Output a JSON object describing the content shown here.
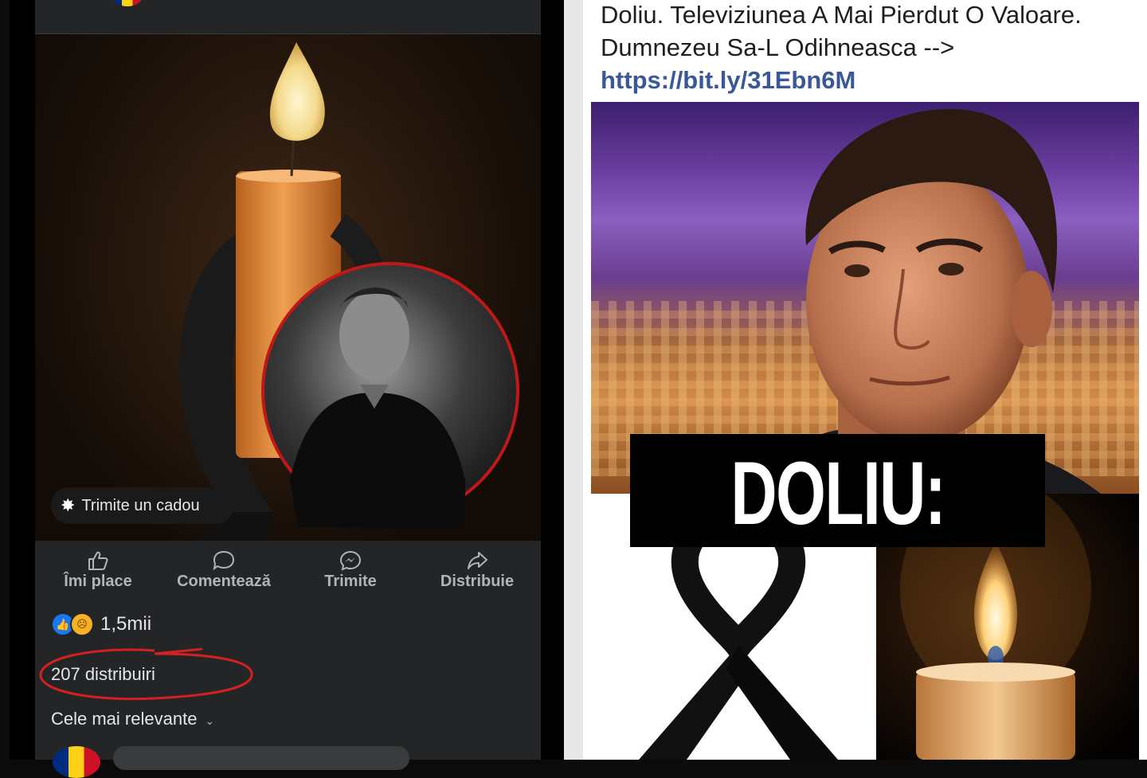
{
  "left_post": {
    "gift_button_label": "Trimite un cadou",
    "actions": {
      "like": "Îmi place",
      "comment": "Comentează",
      "send": "Trimite",
      "share": "Distribuie"
    },
    "reactions_count": "1,5mii",
    "shares_count": "207 distribuiri",
    "sort_label": "Cele mai relevante"
  },
  "right_post": {
    "headline_text": "Doliu. Televiziunea A Mai Pierdut O Valoare. Dumnezeu Sa-L Odihneasca --> ",
    "headline_link": "https://bit.ly/31Ebn6M",
    "banner_text": "DOLIU:"
  },
  "colors": {
    "facebook_dark": "#242526",
    "link_blue": "#385898",
    "annotation_red": "#d42020",
    "candle_orange": "#e08a3a"
  },
  "icons": [
    "gift-icon",
    "thumbs-up-icon",
    "comment-icon",
    "messenger-icon",
    "share-icon",
    "chevron-down-icon",
    "like-reaction-icon",
    "sad-reaction-icon"
  ]
}
